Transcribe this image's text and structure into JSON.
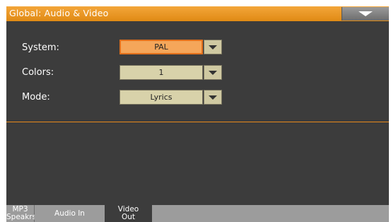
{
  "window": {
    "title": "Global: Audio & Video"
  },
  "fields": [
    {
      "label": "System:",
      "value": "PAL",
      "selected": true
    },
    {
      "label": "Colors:",
      "value": "1",
      "selected": false
    },
    {
      "label": "Mode:",
      "value": "Lyrics",
      "selected": false
    }
  ],
  "tabs": [
    {
      "line1": "MP3",
      "line2": "Speakrs",
      "active": false
    },
    {
      "line1": "Audio In",
      "line2": "",
      "active": false
    },
    {
      "line1": "Video",
      "line2": "Out",
      "active": true
    }
  ],
  "colors": {
    "accent": "#e8891a",
    "panel": "#3c3c3c",
    "field": "#d8d2aa",
    "field_selected": "#f5a65a"
  }
}
